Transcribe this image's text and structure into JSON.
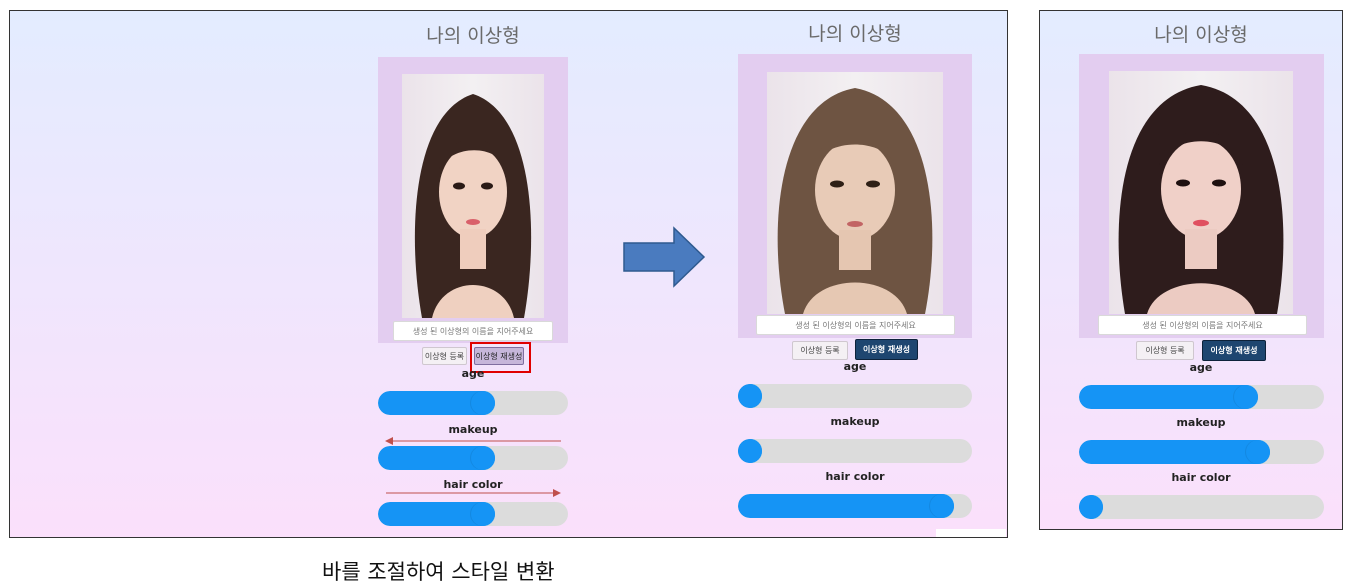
{
  "panels": {
    "before": {
      "title": "나의 이상형",
      "name_placeholder": "생성 된 이상형의 이름을 지어주세요",
      "register_label": "이상형 등록",
      "regenerate_label": "이상형 재생성",
      "sliders": [
        {
          "label": "age",
          "value": 0.55
        },
        {
          "label": "makeup",
          "value": 0.55
        },
        {
          "label": "hair color",
          "value": 0.55
        }
      ]
    },
    "after_center": {
      "title": "나의 이상형",
      "name_placeholder": "생성 된 이상형의 이름을 지어주세요",
      "register_label": "이상형 등록",
      "regenerate_label": "이상형 재생성",
      "sliders": [
        {
          "label": "age",
          "value": 0.05
        },
        {
          "label": "makeup",
          "value": 0.05
        },
        {
          "label": "hair color",
          "value": 0.87
        }
      ]
    },
    "after_right": {
      "title": "나의 이상형",
      "name_placeholder": "생성 된 이상형의 이름을 지어주세요",
      "register_label": "이상형 등록",
      "regenerate_label": "이상형 재생성",
      "sliders": [
        {
          "label": "age",
          "value": 0.68
        },
        {
          "label": "makeup",
          "value": 0.73
        },
        {
          "label": "hair color",
          "value": 0.05
        }
      ]
    }
  },
  "caption": "바를 조절하여 스타일 변환",
  "colors": {
    "slider_fill": "#1594f5",
    "slider_track": "#dcdcdc",
    "highlight": "#e00000",
    "arrow": "#4a7bbf",
    "annotation_arrow": "#c0504d"
  },
  "icons": [
    "right-arrow-icon",
    "left-arrow-icon"
  ]
}
